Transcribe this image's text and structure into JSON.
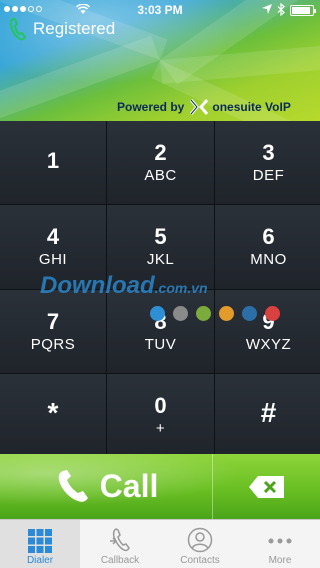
{
  "status_bar": {
    "time": "3:03 PM"
  },
  "header": {
    "registration_status": "Registered"
  },
  "brand": {
    "powered_by": "Powered by",
    "logo_name": "onesuite VoIP"
  },
  "keypad": {
    "keys": [
      {
        "digit": "1",
        "letters": ""
      },
      {
        "digit": "2",
        "letters": "ABC"
      },
      {
        "digit": "3",
        "letters": "DEF"
      },
      {
        "digit": "4",
        "letters": "GHI"
      },
      {
        "digit": "5",
        "letters": "JKL"
      },
      {
        "digit": "6",
        "letters": "MNO"
      },
      {
        "digit": "7",
        "letters": "PQRS"
      },
      {
        "digit": "8",
        "letters": "TUV"
      },
      {
        "digit": "9",
        "letters": "WXYZ"
      },
      {
        "digit": "*",
        "letters": ""
      },
      {
        "digit": "0",
        "letters": "+"
      },
      {
        "digit": "#",
        "letters": ""
      }
    ]
  },
  "watermark": {
    "text": "Download",
    "suffix": ".com.vn"
  },
  "call_bar": {
    "call_label": "Call"
  },
  "tabbar": {
    "tabs": [
      {
        "label": "Dialer",
        "icon": "dialer-grid-icon",
        "active": true
      },
      {
        "label": "Callback",
        "icon": "callback-icon",
        "active": false
      },
      {
        "label": "Contacts",
        "icon": "contacts-icon",
        "active": false
      },
      {
        "label": "More",
        "icon": "more-icon",
        "active": false
      }
    ]
  },
  "colors": {
    "accent_blue": "#2a8ad7",
    "call_green": "#69bf22",
    "keypad_bg": "#1f242b"
  }
}
